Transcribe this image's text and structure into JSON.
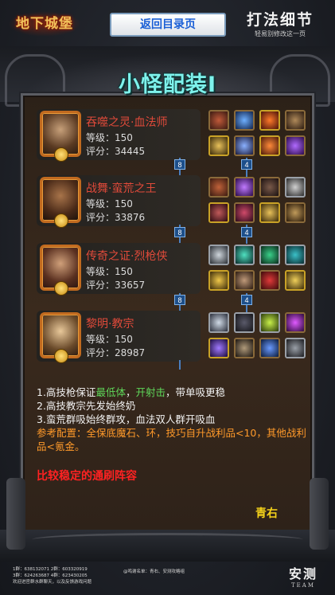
{
  "header": {
    "logo_text": "地下城堡",
    "back_button": "返回目录页",
    "brand_title": "打法细节",
    "brand_subtitle": "轻易别修改这一页"
  },
  "section_title": "小怪配装I",
  "heroes": [
    {
      "name": "吞噬之灵·血法师",
      "level": "等级：150",
      "score": "评分：34445",
      "items_row1": [
        "dragon-helm-icon",
        "blue-orb-icon",
        "fire-mask-icon",
        "horn-icon"
      ],
      "items_row2": [
        "gold-staff-icon",
        "lightning-wand-icon",
        "fire-stone-icon",
        "purple-gem-icon"
      ]
    },
    {
      "name": "战舞·蛮荒之王",
      "level": "等级：150",
      "score": "评分：33876",
      "items_row1": [
        "red-armor-icon",
        "purple-crystal-icon",
        "dark-blade-icon",
        "skull-icon"
      ],
      "items_row2": [
        "dark-gem-icon",
        "bat-wing-icon",
        "ring-icon",
        "chain-icon"
      ]
    },
    {
      "name": "传奇之证·烈枪侠",
      "level": "等级：150",
      "score": "评分：33657",
      "items_row1": [
        "silver-armor-icon",
        "teal-orb-icon",
        "green-stone-icon",
        "teal-stone-icon"
      ],
      "items_row2": [
        "gold-lance-icon",
        "spear-icon",
        "red-sword-icon",
        "gold-ring-icon"
      ]
    },
    {
      "name": "黎明·教宗",
      "level": "等级：150",
      "score": "评分：28987",
      "items_row1": [
        "silver-mask-icon",
        "dark-cloak-icon",
        "green-gem-icon",
        "purple-swirl-icon"
      ],
      "items_row2": [
        "purple-wand-icon",
        "dagger-icon",
        "blue-ring-icon",
        "demon-skull-icon"
      ]
    }
  ],
  "connectors": [
    {
      "left": "8",
      "right": "4"
    },
    {
      "left": "8",
      "right": "4"
    },
    {
      "left": "8",
      "right": "4"
    }
  ],
  "notes": {
    "line1_a": "1.高技枪保证",
    "line1_b": "最低体",
    "line1_c": "，",
    "line1_d": "开射击",
    "line1_e": "，带单吸更稳",
    "line2": "2.高技教宗先发始终奶",
    "line3": "3.蛮荒群吸始终群攻，血法双人群开吸血",
    "ref": "参考配置：全保底魔石、环，技巧自升战利品<10，其他战利品<氪金。"
  },
  "recommend": "比较稳定的通刷阵容",
  "author": "青右",
  "footer": {
    "groups_line1": "1群：638132071   2群：603320919",
    "groups_line2": "3群：624263687   4群：623430205",
    "welcome": "欢迎进官群水群聊天，以及反馈游戏问题",
    "author_note": "@鸣谢名单：青右、安测攻略组",
    "brand_big": "安测",
    "brand_small": "TEAM"
  },
  "colors": {
    "title": "#7ef2ec",
    "hero_name": "#e04a3a",
    "highlight": "#5fd75a",
    "ref": "#ff9a2a",
    "recommend": "#ff2222",
    "author": "#f5d21a",
    "back_button_text": "#1a5fd6"
  }
}
